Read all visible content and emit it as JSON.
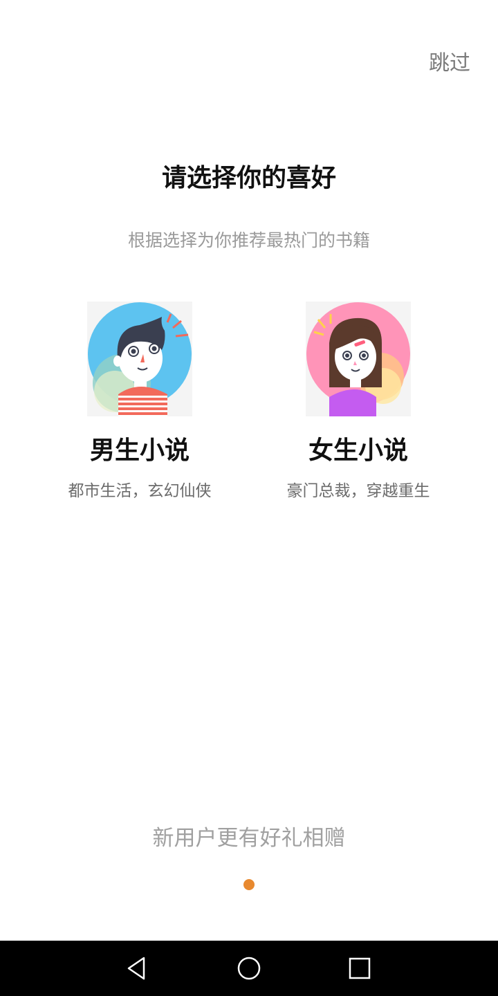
{
  "header": {
    "skip_label": "跳过"
  },
  "main": {
    "title": "请选择你的喜好",
    "subtitle": "根据选择为你推荐最热门的书籍",
    "choices": [
      {
        "title": "男生小说",
        "description": "都市生活，玄幻仙侠",
        "avatar_icon": "boy-avatar-icon"
      },
      {
        "title": "女生小说",
        "description": "豪门总裁，穿越重生",
        "avatar_icon": "girl-avatar-icon"
      }
    ]
  },
  "footer": {
    "promo_text": "新用户更有好礼相赠",
    "page_indicator": {
      "current": 1,
      "total": 1
    }
  },
  "system_nav": {
    "buttons": [
      "back-icon",
      "home-icon",
      "recents-icon"
    ]
  },
  "colors": {
    "accent": "#E8892F",
    "male_bg": "#5DC3F0",
    "female_bg": "#FF94B8",
    "navbar": "#000000"
  }
}
